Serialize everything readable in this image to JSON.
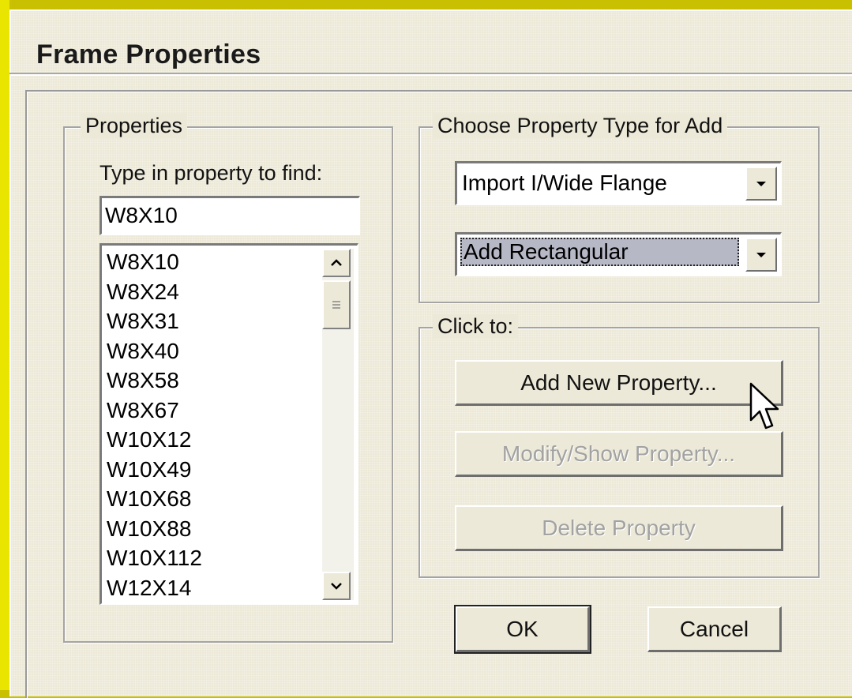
{
  "window": {
    "title": "Frame Properties"
  },
  "properties": {
    "legend": "Properties",
    "find_label": "Type in property to find:",
    "find_value": "W8X10",
    "items": [
      "W8X10",
      "W8X24",
      "W8X31",
      "W8X40",
      "W8X58",
      "W8X67",
      "W10X12",
      "W10X49",
      "W10X68",
      "W10X88",
      "W10X112",
      "W12X14"
    ]
  },
  "property_type": {
    "legend": "Choose Property Type for Add",
    "import_selected": "Import I/Wide Flange",
    "add_selected": "Add Rectangular"
  },
  "actions": {
    "legend": "Click to:",
    "add_new": "Add New Property...",
    "modify": "Modify/Show Property...",
    "delete": "Delete Property"
  },
  "footer": {
    "ok": "OK",
    "cancel": "Cancel"
  },
  "icons": {
    "scroll_up": "chevron-up-icon",
    "scroll_down": "chevron-down-icon",
    "dropdown": "dropdown-arrow-icon",
    "cursor": "mouse-pointer-icon"
  }
}
